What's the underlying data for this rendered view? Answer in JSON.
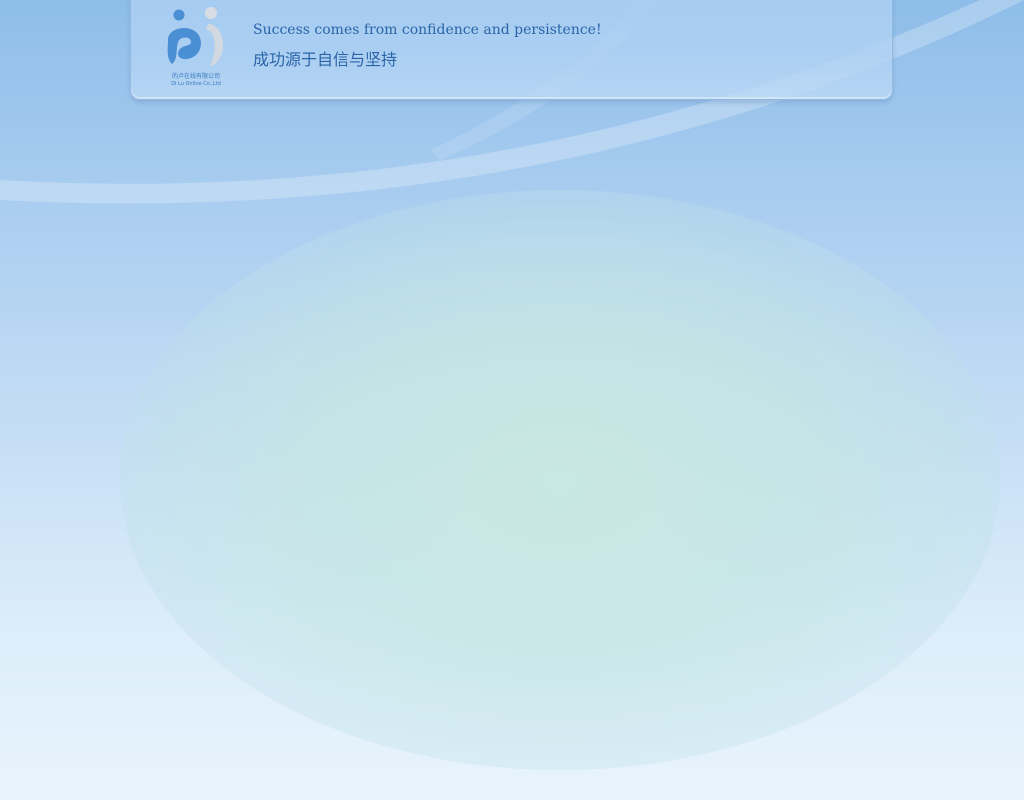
{
  "header": {
    "logo": {
      "icon": "company-logo-icon",
      "name_cn": "的卢在线有限公司",
      "name_en": "Di Lu Online Co.,Ltd"
    },
    "slogan_en": "Success comes from confidence and persistence!",
    "slogan_cn": "成功源于自信与坚持"
  },
  "colors": {
    "background_top": "#8ebde9",
    "background_bottom": "#e8f4fd",
    "accent_text": "#2b64a8",
    "glow": "#c8e8e2"
  }
}
